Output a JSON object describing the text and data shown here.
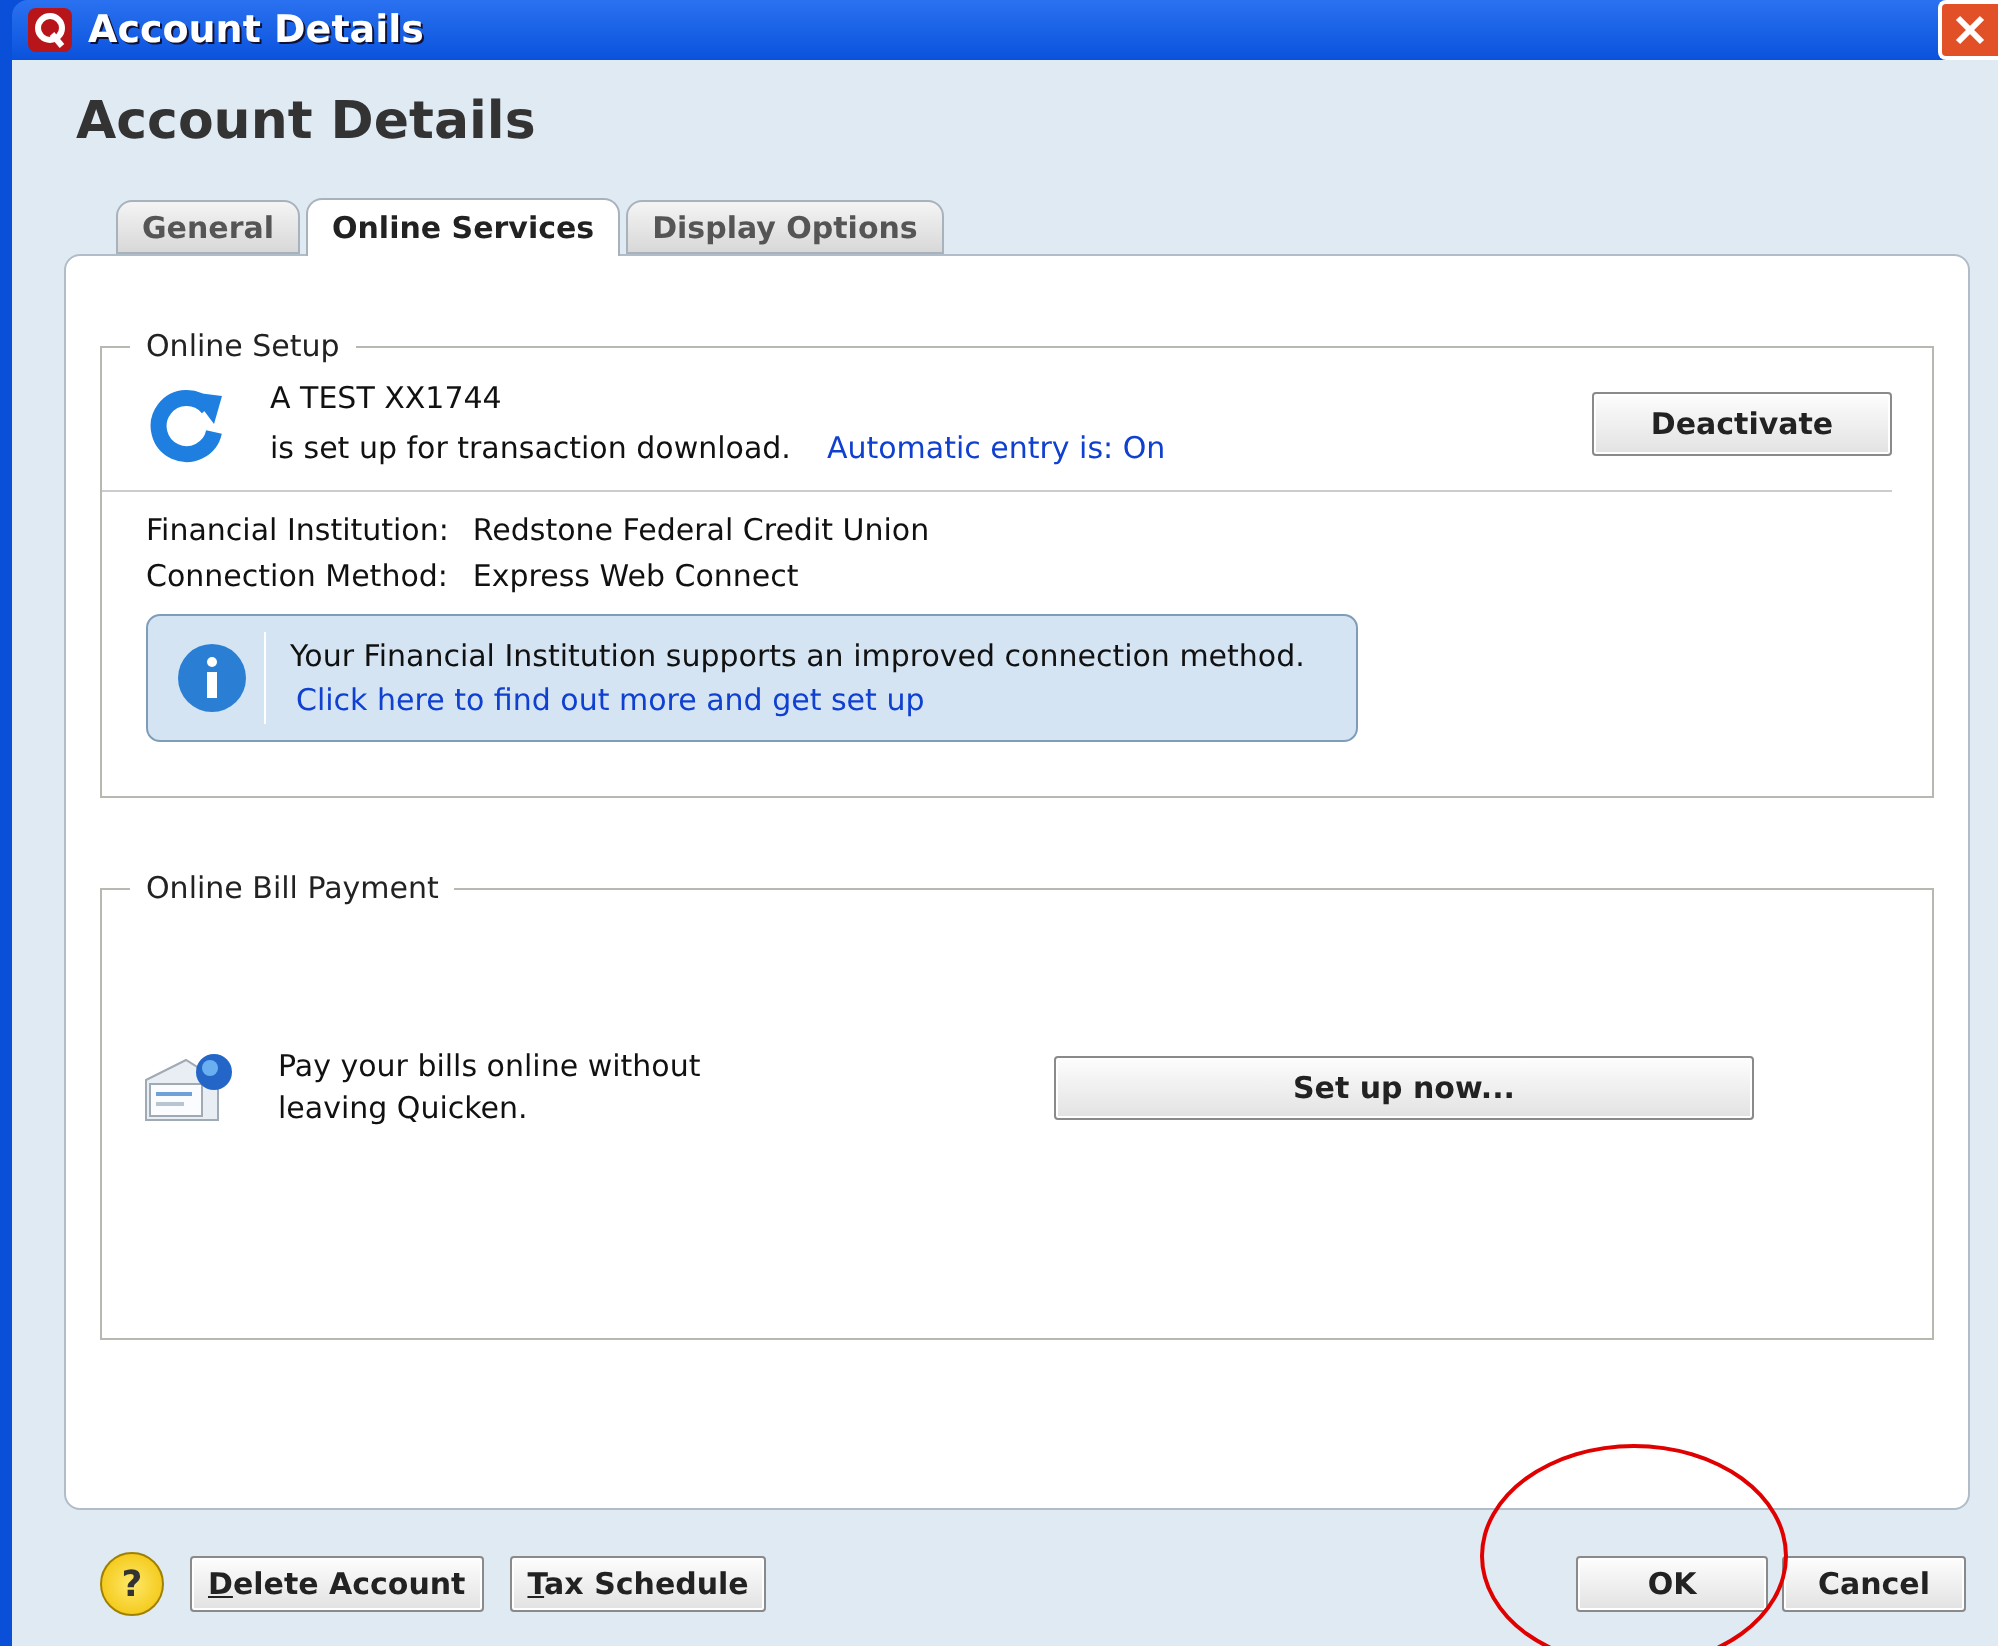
{
  "window": {
    "title": "Account Details"
  },
  "heading": "Account Details",
  "tabs": [
    {
      "label": "General",
      "selected": false
    },
    {
      "label": "Online Services",
      "selected": true
    },
    {
      "label": "Display Options",
      "selected": false
    }
  ],
  "online_setup": {
    "legend": "Online Setup",
    "account": "A TEST XX1744",
    "status": "is set up for transaction download.",
    "auto_entry_link": "Automatic entry is: On",
    "deactivate_button": "Deactivate",
    "details": [
      {
        "label": "Financial Institution:",
        "value": "Redstone Federal Credit Union"
      },
      {
        "label": "Connection Method:",
        "value": "Express Web Connect"
      }
    ],
    "notice": {
      "text": "Your Financial Institution supports an improved connection method.",
      "link": "Click here to find out more and get set up"
    }
  },
  "online_bill_payment": {
    "legend": "Online Bill Payment",
    "text": "Pay your bills online without leaving Quicken.",
    "setup_button": "Set up now..."
  },
  "footer": {
    "help": "?",
    "left_buttons": [
      "Delete Account",
      "Tax Schedule"
    ],
    "ok_button": {
      "label": "OK",
      "circled": true
    },
    "cancel_button": "Cancel"
  }
}
